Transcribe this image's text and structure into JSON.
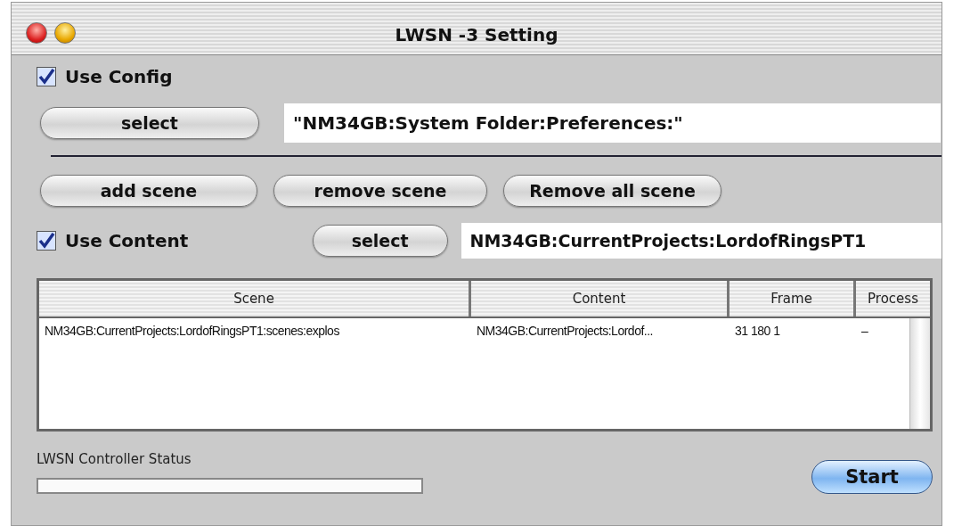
{
  "window": {
    "title": "LWSN -3 Setting"
  },
  "config": {
    "label": "Use Config",
    "checked": true,
    "button": "select",
    "path": "\"NM34GB:System Folder:Preferences:\""
  },
  "scene_buttons": [
    "add scene",
    "remove scene",
    "Remove all scene"
  ],
  "content": {
    "label": "Use Content",
    "checked": true,
    "button": "select",
    "path": "NM34GB:CurrentProjects:LordofRingsPT1"
  },
  "table": {
    "columns": [
      "Scene",
      "Content",
      "Frame",
      "Process"
    ],
    "rows": [
      [
        "NM34GB:CurrentProjects:LordofRingsPT1:scenes:explos",
        "NM34GB:CurrentProjects:Lordof...",
        "31 180 1",
        "–"
      ]
    ]
  },
  "status": {
    "label": "LWSN Controller Status",
    "level": 0
  },
  "start_button": "Start"
}
